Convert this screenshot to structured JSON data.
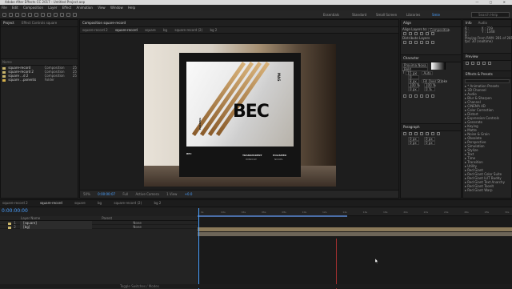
{
  "app": {
    "title": "Adobe After Effects CC 2017 - Untitled Project.aep"
  },
  "menu": [
    "File",
    "Edit",
    "Composition",
    "Layer",
    "Effect",
    "Animation",
    "View",
    "Window",
    "Help"
  ],
  "workspaces": {
    "items": [
      "Essentials",
      "Standard",
      "Small Screen",
      "Libraries",
      "Smie"
    ],
    "active_index": 4
  },
  "search_placeholder": "Search Help",
  "project": {
    "tabs": [
      "Project",
      "Effect Controls square"
    ],
    "header": "Name",
    "items": [
      {
        "name": "square-record",
        "type": "Composition",
        "size": "25",
        "color": "#c8b46a"
      },
      {
        "name": "square-record 2",
        "type": "Composition",
        "size": "25",
        "color": "#c8b46a"
      },
      {
        "name": "square ...d 2",
        "type": "Composition",
        "size": "25",
        "color": "#c8b46a"
      },
      {
        "name": "square ...ponents",
        "type": "Folder",
        "size": "",
        "color": "#d8b24a"
      }
    ]
  },
  "composition": {
    "tabs": [
      "Composition square-record"
    ],
    "breadcrumbs": [
      "square-record 2",
      "square-record",
      "square",
      "bg",
      "square-record (2)",
      "bg 2"
    ],
    "poster": {
      "headline": "BEC",
      "side_text": "PARKING",
      "vertical_label": "MAG",
      "footer_left": "BEC",
      "footer_col2_title": "TRANSPARENT",
      "footer_col2_sub": "WINDOW",
      "footer_col3_title": "POLISHED",
      "footer_col3_sub": "NICKEL"
    },
    "view_controls": [
      "50%",
      "0:00:00:07",
      "Full",
      "Active Camera",
      "1 View",
      "+0.0"
    ]
  },
  "align": {
    "title": "Align",
    "align_to_label": "Align Layers to:",
    "align_to_value": "Composition",
    "distribute_label": "Distribute Layers"
  },
  "character": {
    "title": "Character",
    "font": "Proxima Nova",
    "style": "Bold",
    "size": "15 px",
    "leading": "Auto",
    "tracking": "0",
    "stroke": "8 px",
    "stroke_mode": "Fill Over Stroke",
    "scale_v": "100 %",
    "scale_h": "100 %",
    "baseline": "0 px",
    "tsume": "0 %"
  },
  "paragraph": {
    "title": "Paragraph",
    "indent_left": "0 px",
    "indent_right": "0 px",
    "space_before": "0 px",
    "space_after": "0 px"
  },
  "info": {
    "tabs": [
      "Info",
      "Audio"
    ],
    "r": "R :",
    "g": "G :",
    "b": "B :",
    "x": "X : 729",
    "y": "Y : 1348",
    "playing": "Playing From RAM: 281 of 281",
    "fps": "fps: 30 (realtime)"
  },
  "preview": {
    "title": "Preview"
  },
  "effects": {
    "title": "Effects & Presets",
    "items": [
      "* Animation Presets",
      "3D Channel",
      "Audio",
      "Blur & Sharpen",
      "Channel",
      "CINEMA 4D",
      "Color Correction",
      "Distort",
      "Expression Controls",
      "Generate",
      "Keying",
      "Matte",
      "Noise & Grain",
      "Obsolete",
      "Perspective",
      "Simulation",
      "Stylize",
      "Text",
      "Time",
      "Transition",
      "Utility",
      "Red Giant",
      "Red Giant Color Suite",
      "Red Giant LUT Buddy",
      "Red Giant Text Anarchy",
      "Red Giant ToonIt",
      "Red Giant Warp"
    ]
  },
  "timeline": {
    "tabs": [
      "square-record 2",
      "square-record",
      "square",
      "bg",
      "square-record (2)",
      "bg 2"
    ],
    "active_tab": 1,
    "timecode": "0:00:00:00",
    "header": [
      "Layer Name",
      "Parent"
    ],
    "layers": [
      {
        "num": "1",
        "name": "[square]",
        "parent": "None",
        "color": "#c8b46a"
      },
      {
        "num": "2",
        "name": "[bg]",
        "parent": "None",
        "color": "#c8b46a"
      }
    ],
    "ruler": [
      "0s",
      "02s",
      "04s",
      "06s",
      "08s",
      "10s",
      "12s",
      "14s",
      "16s",
      "18s",
      "20s",
      "22s",
      "24s",
      "26s",
      "28s",
      "30s"
    ],
    "bar_colors": [
      "#8b7a5a",
      "#6e6659"
    ],
    "status": "Toggle Switches / Modes"
  }
}
